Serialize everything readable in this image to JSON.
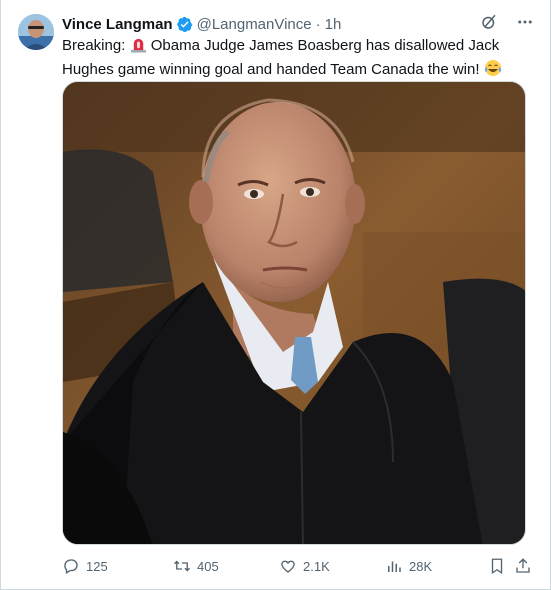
{
  "post": {
    "author_name": "Vince Langman",
    "handle": "@LangmanVince",
    "separator": "·",
    "time": "1h",
    "text_prefix": "Breaking:",
    "text_body": "Obama Judge James Boasberg has disallowed Jack Hughes game winning goal and handed Team Canada the win!",
    "emoji_siren": "siren-icon",
    "emoji_laugh": "tears-of-joy-icon"
  },
  "actions": {
    "replies": "125",
    "reposts": "405",
    "likes": "2.1K",
    "views": "28K"
  },
  "colors": {
    "text": "#0f1419",
    "secondary": "#536471",
    "verified": "#1d9bf0",
    "border": "#cfd9de"
  }
}
